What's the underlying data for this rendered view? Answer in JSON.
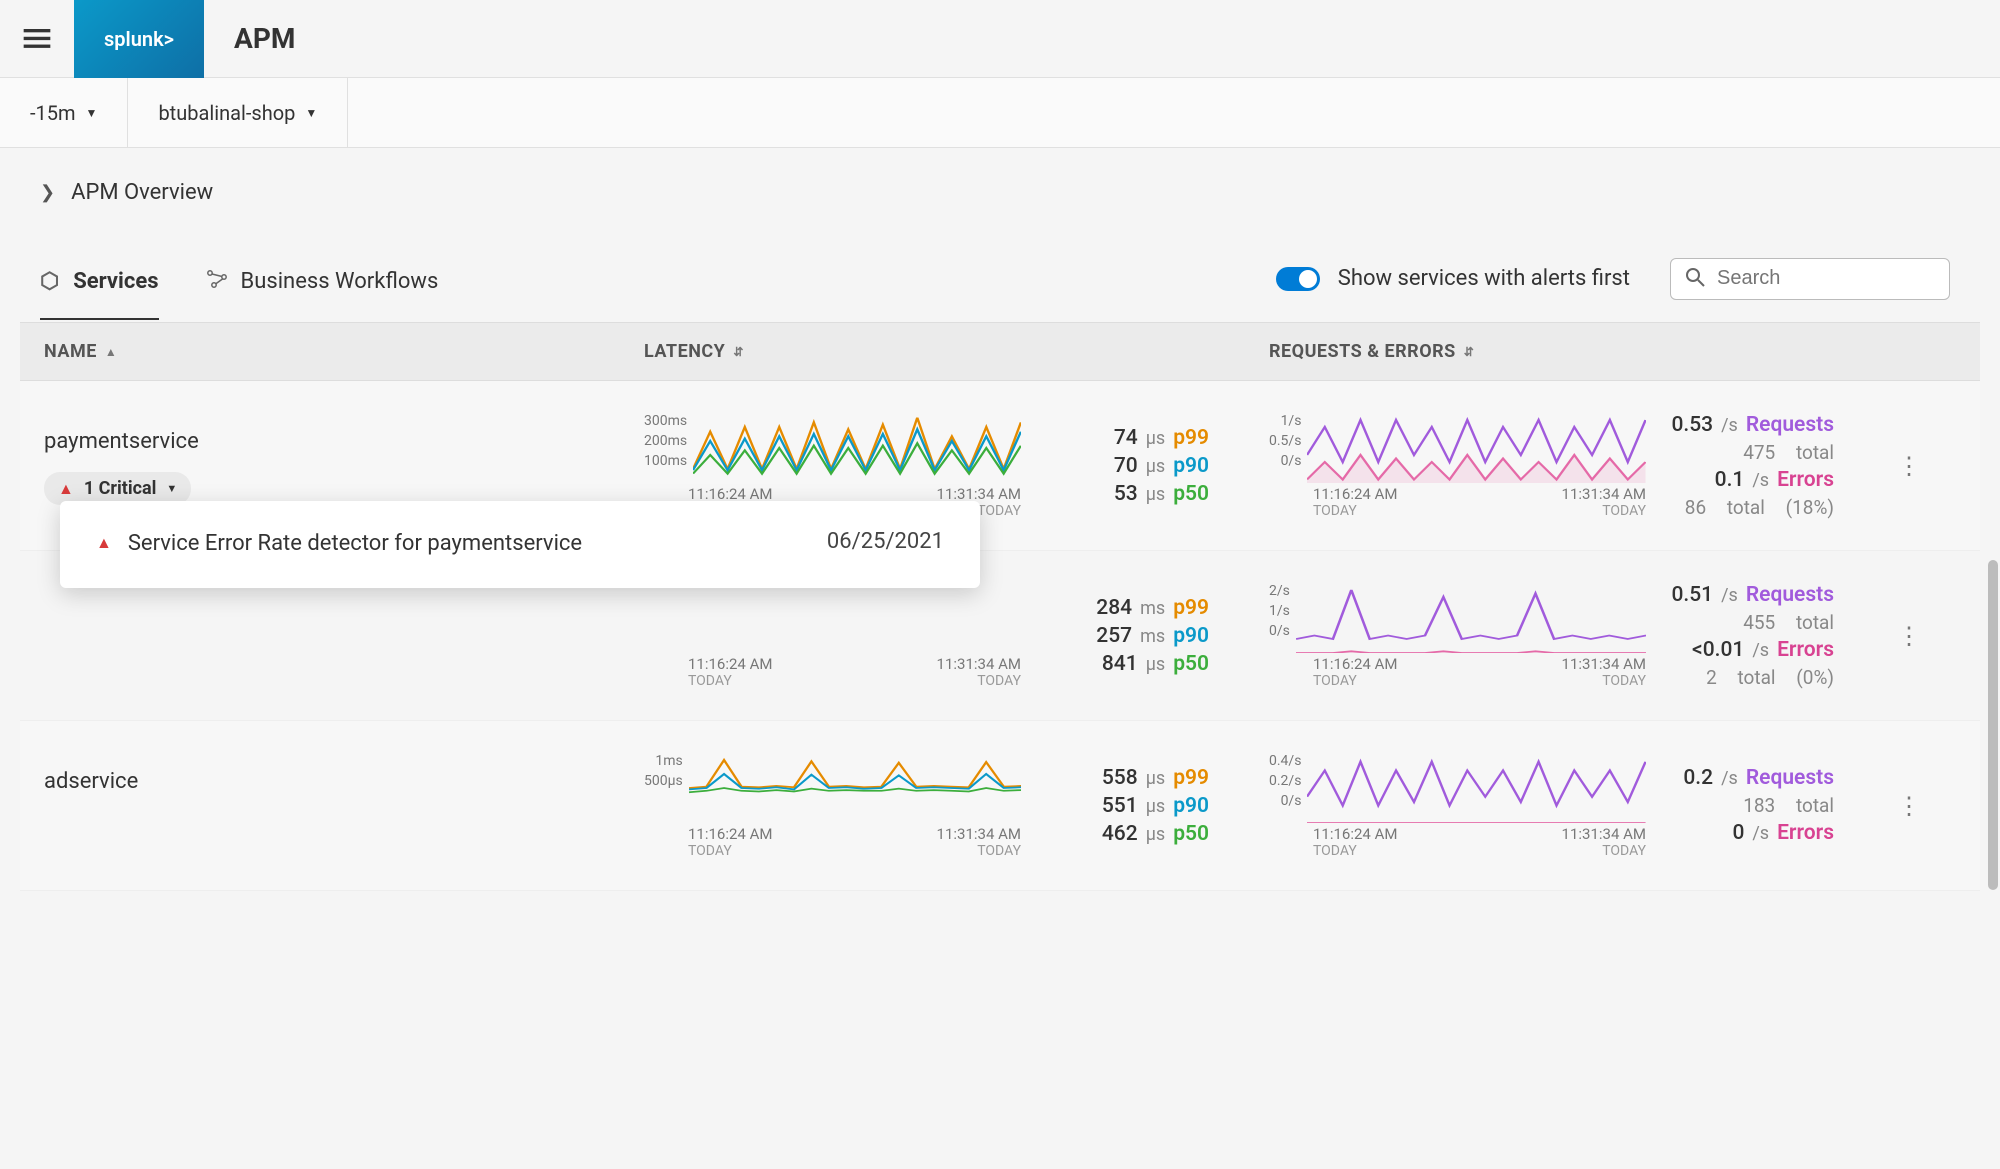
{
  "app": {
    "title": "APM",
    "logo_text": "splunk>"
  },
  "filters": {
    "timerange": "-15m",
    "environment": "btubalinal-shop"
  },
  "breadcrumb": {
    "label": "APM Overview"
  },
  "tabs": {
    "services": "Services",
    "workflows": "Business Workflows",
    "active": "services"
  },
  "toggle": {
    "label": "Show services with alerts first",
    "on": true
  },
  "search": {
    "placeholder": "Search"
  },
  "columns": {
    "name": "NAME",
    "latency": "LATENCY",
    "reqerr": "REQUESTS & ERRORS"
  },
  "chart_axes": {
    "x": [
      "11:16:24 AM",
      "11:31:34 AM"
    ],
    "today": "TODAY"
  },
  "latency_legend": {
    "p99": "p99",
    "p90": "p90",
    "p50": "p50"
  },
  "req_legend": {
    "requests": "Requests",
    "errors": "Errors",
    "total": "total"
  },
  "popover": {
    "message": "Service Error Rate detector for paymentservice",
    "date": "06/25/2021"
  },
  "services": [
    {
      "name": "paymentservice",
      "alert": {
        "count": "1 Critical",
        "has": true
      },
      "latency": {
        "yticks": [
          "300ms",
          "200ms",
          "100ms"
        ],
        "p99": {
          "val": "74",
          "unit": "μs"
        },
        "p90": {
          "val": "70",
          "unit": "μs"
        },
        "p50": {
          "val": "53",
          "unit": "μs"
        }
      },
      "reqerr": {
        "yticks": [
          "1/s",
          "0.5/s",
          "0/s"
        ],
        "requests": {
          "rate": "0.53",
          "unit": "/s",
          "total": "475"
        },
        "errors": {
          "rate": "0.1",
          "unit": "/s",
          "total": "86",
          "pct": "(18%)"
        }
      }
    },
    {
      "name": "",
      "latency": {
        "yticks": [
          "",
          "",
          ""
        ],
        "p99": {
          "val": "284",
          "unit": "ms"
        },
        "p90": {
          "val": "257",
          "unit": "ms"
        },
        "p50": {
          "val": "841",
          "unit": "μs"
        }
      },
      "reqerr": {
        "yticks": [
          "2/s",
          "1/s",
          "0/s"
        ],
        "requests": {
          "rate": "0.51",
          "unit": "/s",
          "total": "455"
        },
        "errors": {
          "rate": "<0.01",
          "unit": "/s",
          "total": "2",
          "pct": "(0%)"
        }
      }
    },
    {
      "name": "adservice",
      "latency": {
        "yticks": [
          "1ms",
          "500μs",
          ""
        ],
        "p99": {
          "val": "558",
          "unit": "μs"
        },
        "p90": {
          "val": "551",
          "unit": "μs"
        },
        "p50": {
          "val": "462",
          "unit": "μs"
        }
      },
      "reqerr": {
        "yticks": [
          "0.4/s",
          "0.2/s",
          "0/s"
        ],
        "requests": {
          "rate": "0.2",
          "unit": "/s",
          "total": "183"
        },
        "errors": {
          "rate": "0",
          "unit": "/s",
          "total": "",
          "pct": ""
        }
      }
    }
  ],
  "chart_data": [
    {
      "type": "line",
      "title": "paymentservice latency",
      "xrange": [
        "11:16:24 AM",
        "11:31:34 AM"
      ],
      "ylim": [
        0,
        300
      ],
      "yunit": "ms",
      "series": [
        {
          "name": "p99",
          "color": "#e58b00",
          "values": [
            60,
            220,
            60,
            240,
            60,
            240,
            60,
            260,
            60,
            230,
            60,
            250,
            60,
            280,
            60,
            200,
            60,
            240,
            60,
            260
          ]
        },
        {
          "name": "p90",
          "color": "#0b99c9",
          "values": [
            55,
            180,
            55,
            190,
            55,
            200,
            55,
            210,
            55,
            200,
            55,
            210,
            55,
            230,
            55,
            180,
            55,
            200,
            55,
            220
          ]
        },
        {
          "name": "p50",
          "color": "#3cae3c",
          "values": [
            40,
            120,
            40,
            140,
            40,
            150,
            40,
            160,
            40,
            150,
            40,
            160,
            40,
            170,
            40,
            140,
            40,
            150,
            40,
            160
          ]
        }
      ]
    },
    {
      "type": "line",
      "title": "paymentservice requests & errors",
      "xrange": [
        "11:16:24 AM",
        "11:31:34 AM"
      ],
      "ylim": [
        0,
        1
      ],
      "yunit": "/s",
      "series": [
        {
          "name": "requests",
          "color": "#a15bdc",
          "values": [
            0.4,
            0.8,
            0.3,
            0.9,
            0.3,
            0.9,
            0.4,
            0.8,
            0.3,
            0.9,
            0.3,
            0.8,
            0.4,
            0.9,
            0.3,
            0.8,
            0.4,
            0.9,
            0.3,
            0.9
          ]
        },
        {
          "name": "errors",
          "color": "#e56aa8",
          "values": [
            0.05,
            0.3,
            0.05,
            0.4,
            0.05,
            0.35,
            0.05,
            0.3,
            0.05,
            0.4,
            0.05,
            0.35,
            0.05,
            0.3,
            0.05,
            0.4,
            0.05,
            0.35,
            0.05,
            0.3
          ]
        }
      ]
    },
    {
      "type": "line",
      "title": "row2 latency hidden (behind popover)",
      "xrange": [
        "11:16:24 AM",
        "11:31:34 AM"
      ],
      "ylim": [
        0,
        300
      ],
      "yunit": "ms",
      "series": []
    },
    {
      "type": "line",
      "title": "row2 requests & errors",
      "xrange": [
        "11:16:24 AM",
        "11:31:34 AM"
      ],
      "ylim": [
        0,
        2
      ],
      "yunit": "/s",
      "series": [
        {
          "name": "requests",
          "color": "#a15bdc",
          "values": [
            0.4,
            0.5,
            0.4,
            1.8,
            0.4,
            0.5,
            0.4,
            0.5,
            1.6,
            0.4,
            0.5,
            0.4,
            0.5,
            1.7,
            0.4,
            0.5,
            0.4,
            0.5,
            0.4,
            0.5
          ]
        },
        {
          "name": "errors",
          "color": "#e56aa8",
          "values": [
            0.0,
            0.0,
            0.0,
            0.05,
            0.0,
            0.0,
            0.0,
            0.0,
            0.05,
            0.0,
            0.0,
            0.0,
            0.0,
            0.05,
            0.0,
            0.0,
            0.0,
            0.0,
            0.0,
            0.0
          ]
        }
      ]
    },
    {
      "type": "line",
      "title": "adservice latency",
      "xrange": [
        "11:16:24 AM",
        "11:31:34 AM"
      ],
      "ylim": [
        0,
        1000
      ],
      "yunit": "μs",
      "series": [
        {
          "name": "p99",
          "color": "#e58b00",
          "values": [
            500,
            520,
            900,
            520,
            510,
            530,
            510,
            880,
            520,
            530,
            510,
            520,
            860,
            520,
            530,
            520,
            510,
            870,
            520,
            530
          ]
        },
        {
          "name": "p90",
          "color": "#0b99c9",
          "values": [
            480,
            500,
            700,
            500,
            490,
            510,
            480,
            690,
            500,
            510,
            490,
            500,
            680,
            500,
            510,
            500,
            490,
            700,
            500,
            510
          ]
        },
        {
          "name": "p50",
          "color": "#3cae3c",
          "values": [
            440,
            460,
            500,
            460,
            450,
            470,
            450,
            490,
            460,
            470,
            460,
            460,
            490,
            460,
            470,
            460,
            450,
            500,
            460,
            470
          ]
        }
      ]
    },
    {
      "type": "line",
      "title": "adservice requests & errors",
      "xrange": [
        "11:16:24 AM",
        "11:31:34 AM"
      ],
      "ylim": [
        0,
        0.4
      ],
      "yunit": "/s",
      "series": [
        {
          "name": "requests",
          "color": "#a15bdc",
          "values": [
            0.15,
            0.3,
            0.1,
            0.35,
            0.1,
            0.3,
            0.12,
            0.35,
            0.1,
            0.3,
            0.15,
            0.3,
            0.12,
            0.35,
            0.1,
            0.3,
            0.15,
            0.3,
            0.12,
            0.35
          ]
        },
        {
          "name": "errors",
          "color": "#e56aa8",
          "values": [
            0,
            0,
            0,
            0,
            0,
            0,
            0,
            0,
            0,
            0,
            0,
            0,
            0,
            0,
            0,
            0,
            0,
            0,
            0,
            0
          ]
        }
      ]
    }
  ]
}
